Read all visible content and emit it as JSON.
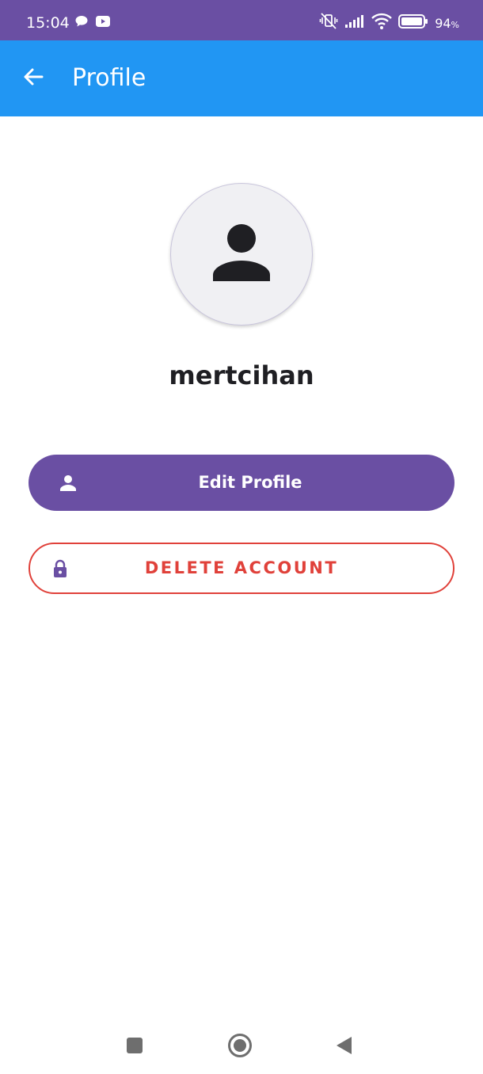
{
  "status_bar": {
    "time": "15:04",
    "battery_percent": "94",
    "battery_unit": "%",
    "icons": [
      "chat-bubble-icon",
      "youtube-icon",
      "vibrate-off-icon",
      "signal-icon",
      "wifi-icon",
      "battery-icon"
    ]
  },
  "app_bar": {
    "title": "Profile",
    "back_icon": "arrow-left-icon"
  },
  "profile": {
    "avatar_icon": "person-icon",
    "username": "mertcihan"
  },
  "actions": {
    "edit_label": "Edit Profile",
    "edit_icon": "person-icon",
    "delete_label": "DELETE ACCOUNT",
    "delete_icon": "lock-icon"
  },
  "nav_bar": {
    "recents_icon": "square-icon",
    "home_icon": "circle-icon",
    "back_icon": "triangle-back-icon"
  },
  "colors": {
    "status_bar": "#6a4fa3",
    "app_bar": "#2196f3",
    "primary": "#6a4fa3",
    "danger": "#e0413a"
  }
}
